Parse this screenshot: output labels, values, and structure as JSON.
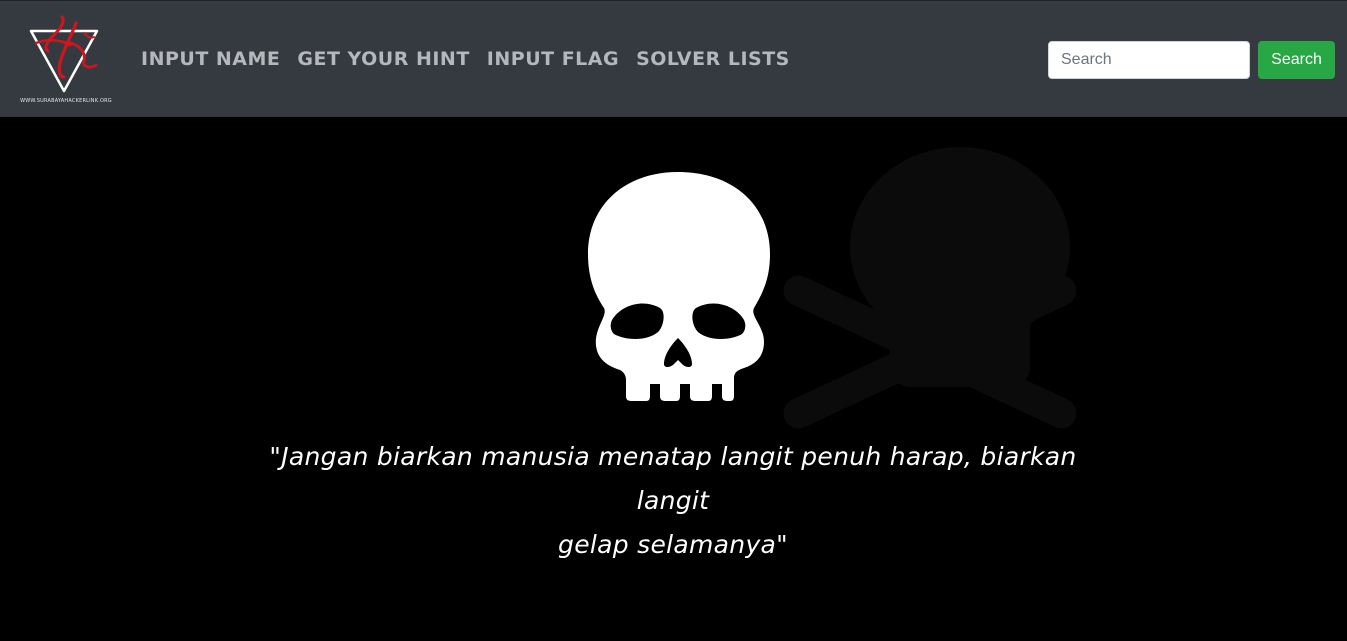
{
  "navbar": {
    "logo": {
      "icon": "shl-triangle-logo",
      "url_text": "WWW.SURABAYAHACKERLINK.ORG"
    },
    "links": [
      {
        "label": "INPUT NAME"
      },
      {
        "label": "GET YOUR HINT"
      },
      {
        "label": "INPUT FLAG"
      },
      {
        "label": "SOLVER LISTS"
      }
    ],
    "search": {
      "placeholder": "Search",
      "button_label": "Search"
    }
  },
  "hero": {
    "icon": "skull-icon",
    "quote_line1": "\"Jangan biarkan manusia menatap langit penuh harap, biarkan langit",
    "quote_line2": "gelap selamanya\""
  },
  "colors": {
    "navbar_bg": "#343a40",
    "nav_link": "#b5b7ba",
    "search_button": "#28a745",
    "logo_red": "#d4141c",
    "hero_bg": "#000000"
  }
}
